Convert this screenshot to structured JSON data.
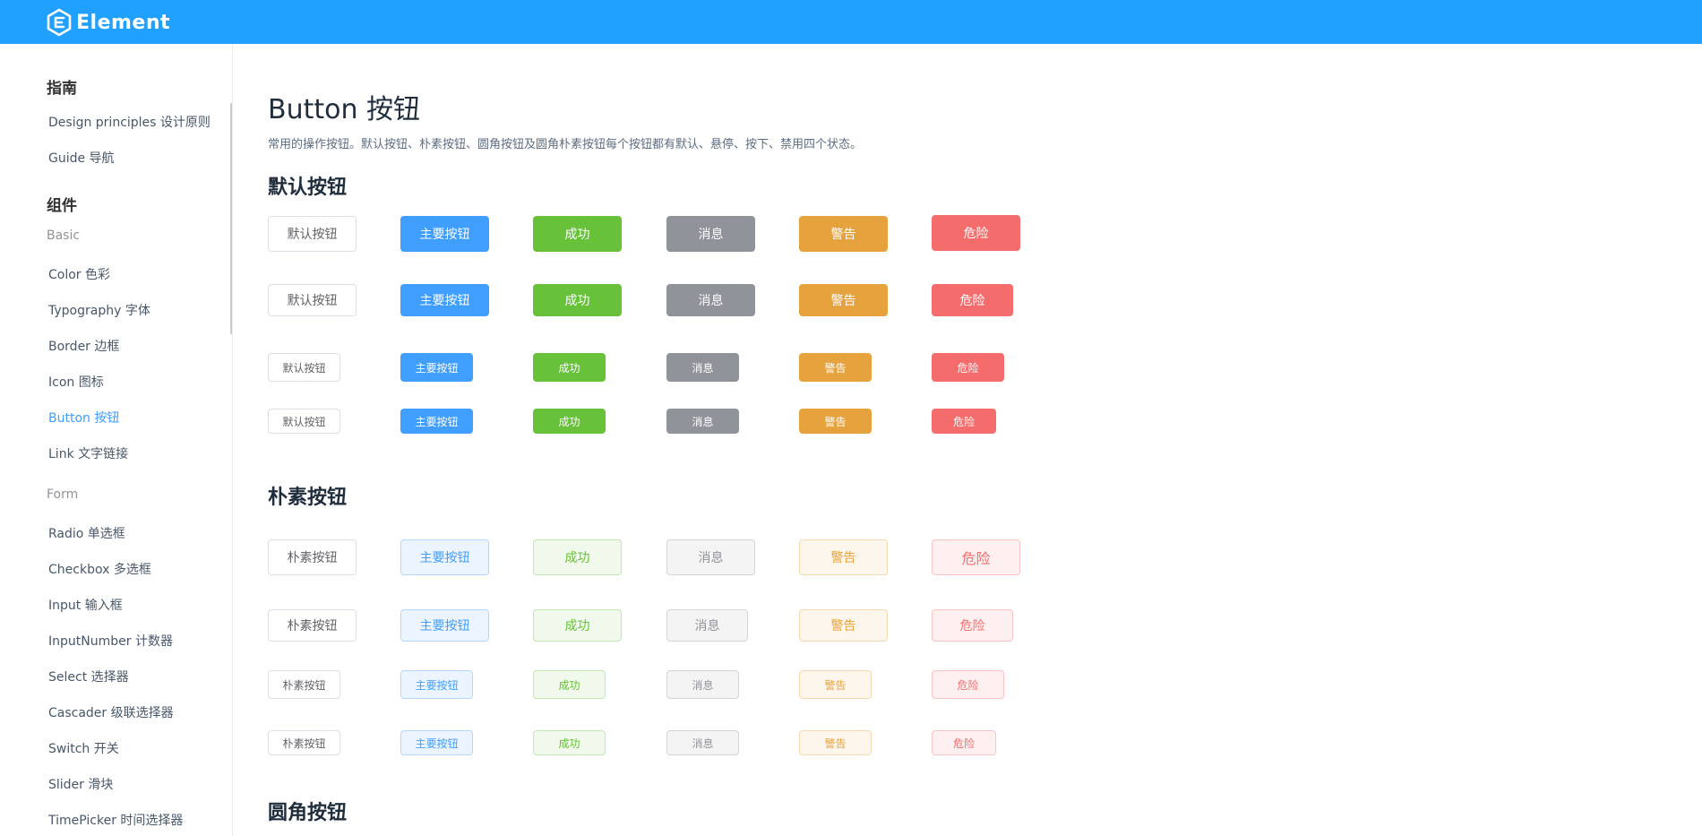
{
  "header": {
    "brand": "Element",
    "logo_icon": "element-logo-icon"
  },
  "sidebar": {
    "guide_group": "指南",
    "guide_items": [
      "Design principles  设计原则",
      "Guide 导航"
    ],
    "component_group": "组件",
    "basic_label": "Basic",
    "basic_items": [
      "Color 色彩",
      "Typography 字体",
      "Border 边框",
      "Icon 图标",
      "Button 按钮",
      "Link 文字链接"
    ],
    "active_item": "Button 按钮",
    "form_label": "Form",
    "form_items": [
      "Radio 单选框",
      "Checkbox 多选框",
      "Input 输入框",
      "InputNumber 计数器",
      "Select 选择器",
      "Cascader 级联选择器",
      "Switch 开关",
      "Slider 滑块",
      "TimePicker 时间选择器"
    ]
  },
  "main": {
    "title": "Button 按钮",
    "description": "常用的操作按钮。默认按钮、朴素按钮、圆角按钮及圆角朴素按钮每个按钮都有默认、悬停、按下、禁用四个状态。",
    "sections": {
      "default": {
        "title": "默认按钮",
        "labels": [
          "默认按钮",
          "主要按钮",
          "成功",
          "消息",
          "警告",
          "危险"
        ]
      },
      "plain": {
        "title": "朴素按钮",
        "labels": [
          "朴素按钮",
          "主要按钮",
          "成功",
          "消息",
          "警告",
          "危险"
        ]
      },
      "round": {
        "title": "圆角按钮"
      }
    }
  },
  "colors": {
    "header": "#20a0ff",
    "primary": "#409eff",
    "success": "#67c23a",
    "info": "#909399",
    "warning": "#e6a23c",
    "danger": "#f56c6c"
  }
}
